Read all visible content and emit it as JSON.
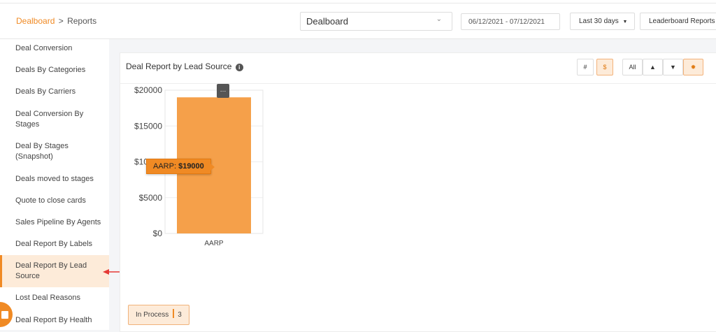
{
  "header": {
    "breadcrumb_home": "Dealboard",
    "breadcrumb_sep": ">",
    "breadcrumb_current": "Reports",
    "board_select": "Dealboard",
    "date_range": "06/12/2021 - 07/12/2021",
    "range_preset": "Last 30 days",
    "leaderboard_label": "Leaderboard Reports"
  },
  "sidebar": {
    "items": [
      {
        "label": "Deal Conversion"
      },
      {
        "label": "Deals By Categories"
      },
      {
        "label": "Deals By Carriers"
      },
      {
        "label": "Deal Conversion By Stages"
      },
      {
        "label": "Deal By Stages (Snapshot)"
      },
      {
        "label": "Deals moved to stages"
      },
      {
        "label": "Quote to close cards"
      },
      {
        "label": "Sales Pipeline By Agents"
      },
      {
        "label": "Deal Report By Labels"
      },
      {
        "label": "Deal Report By Lead Source",
        "active": true
      },
      {
        "label": "Lost Deal Reasons"
      },
      {
        "label": "Deal Report By Health"
      }
    ]
  },
  "panel": {
    "title": "Deal Report by Lead Source",
    "toggles": {
      "count": "#",
      "amount": "$",
      "all": "All"
    }
  },
  "chart_data": {
    "type": "bar",
    "categories": [
      "AARP"
    ],
    "values": [
      19000
    ],
    "ylim": [
      0,
      20000
    ],
    "yticks": [
      "$20000",
      "$15000",
      "$10000",
      "$5000",
      "$0"
    ],
    "bar_color": "#f5a04a",
    "tooltip": {
      "label": "AARP:",
      "value": "$19000"
    }
  },
  "status": {
    "label": "In Process",
    "count": "3"
  },
  "colors": {
    "accent": "#f08a24"
  }
}
